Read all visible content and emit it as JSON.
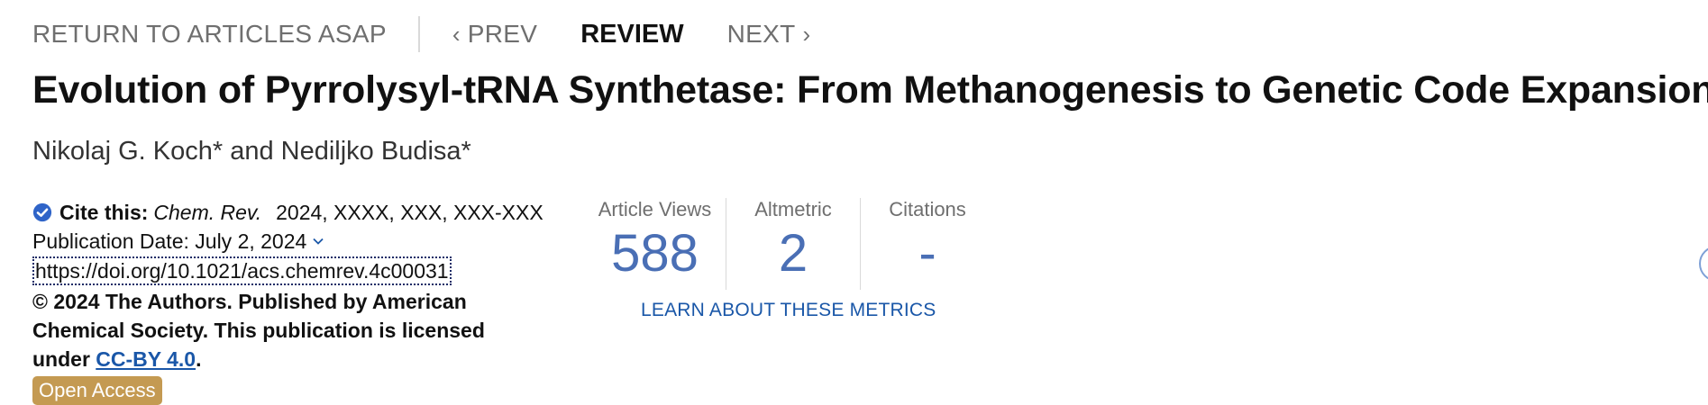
{
  "nav": {
    "return_label": "RETURN TO ARTICLES ASAP",
    "prev_label": "PREV",
    "current_label": "REVIEW",
    "next_label": "NEXT"
  },
  "article": {
    "title": "Evolution of Pyrrolysyl-tRNA Synthetase: From Methanogenesis to Genetic Code Expansion",
    "authors": "Nikolaj G. Koch* and Nediljko Budisa*"
  },
  "meta": {
    "cite_label": "Cite this:",
    "journal": "Chem. Rev.",
    "citation": "2024, XXXX, XXX, XXX-XXX",
    "publication_date": "Publication Date: July 2, 2024",
    "doi": "https://doi.org/10.1021/acs.chemrev.4c00031",
    "license_prefix": "© 2024 The Authors. Published by American Chemical Society. This publication is licensed under ",
    "license_link": "CC-BY 4.0",
    "license_suffix": ".",
    "open_access": "Open Access"
  },
  "metrics": {
    "views_label": "Article Views",
    "views_value": "588",
    "altmetric_label": "Altmetric",
    "altmetric_value": "2",
    "citations_label": "Citations",
    "citations_value": "-",
    "learn_link": "LEARN ABOUT THESE METRICS"
  },
  "colors": {
    "metric_blue": "#4a6fb5",
    "link_blue": "#1a57a8",
    "open_access_gold": "#c49a52"
  },
  "icons": [
    "check-badge-icon",
    "chevron-left-icon",
    "chevron-right-icon",
    "chevron-down-icon"
  ]
}
